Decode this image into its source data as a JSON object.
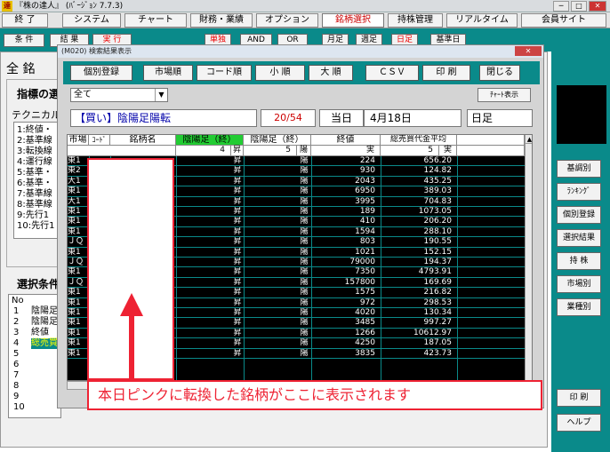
{
  "window": {
    "title": "『株の達人』 (ﾊﾞｰｼﾞｮﾝ 7.7.3)",
    "icon_text": "達",
    "btn_min": "─",
    "btn_max": "□",
    "btn_close": "✕"
  },
  "menu": [
    "終 了",
    "システム",
    "チャート",
    "財務・業績",
    "オプション",
    "銘柄選択",
    "持株管理",
    "リアルタイム",
    "会員サイト"
  ],
  "toolbar": {
    "left": [
      "条 件",
      "結 果",
      "実 行"
    ],
    "right": [
      "単独",
      "AND",
      "OR",
      "月足",
      "週足",
      "日足",
      "基準日"
    ]
  },
  "background": {
    "label1": "全 銘",
    "label2": "指標の選",
    "label3": "テクニカル",
    "list": [
      "1:終値・",
      "2:基準線",
      "3:転換線",
      "4:運行線",
      "5:基準・",
      "6:基準・",
      "7:基準線",
      "8:基準線",
      "9:先行1",
      "10:先行1"
    ],
    "sel_label": "選択条件",
    "sel_head": "No",
    "sel_rows": [
      {
        "no": "1",
        "val": "陰陽足"
      },
      {
        "no": "2",
        "val": "陰陽足"
      },
      {
        "no": "3",
        "val": "終値"
      },
      {
        "no": "4",
        "val": "総売買"
      },
      {
        "no": "5",
        "val": ""
      },
      {
        "no": "6",
        "val": ""
      },
      {
        "no": "7",
        "val": ""
      },
      {
        "no": "8",
        "val": ""
      },
      {
        "no": "9",
        "val": ""
      },
      {
        "no": "10",
        "val": ""
      }
    ]
  },
  "side": [
    "基調別",
    "ﾗﾝｷﾝｸﾞ",
    "個別登録",
    "選択結果",
    "持 株",
    "市場別",
    "業種別",
    "印 刷",
    "ヘルプ"
  ],
  "dialog": {
    "title": "(M020) 検索結果表示",
    "buttons": [
      "個別登録",
      "市場順",
      "コード順",
      "小 順",
      "大 順",
      "ＣＳＶ",
      "印 刷",
      "閉じる"
    ],
    "filter": "全て",
    "chart_btn": "ﾁｬｰﾄ表示",
    "info": {
      "label": "【買い】陰陽足陽転",
      "count": "20/54",
      "date_label": "当日",
      "date": "4月18日",
      "period": "日足"
    },
    "columns": [
      "市場",
      "ｺｰﾄﾞ",
      "銘柄名",
      "陰陽足（終）",
      "陰陽足（終）",
      "終値",
      "総売買代金平均"
    ],
    "subrow": {
      "c1": "4",
      "c1s": "昇",
      "c2": "5",
      "c2s": "陽",
      "c3": "実",
      "c4": "5",
      "c4s": "実"
    },
    "rows": [
      [
        "東1",
        "昇",
        "陽",
        "224",
        "656.20"
      ],
      [
        "東2",
        "昇",
        "陽",
        "930",
        "124.82"
      ],
      [
        "大1",
        "昇",
        "陽",
        "2043",
        "435.25"
      ],
      [
        "東1",
        "昇",
        "陽",
        "6950",
        "389.03"
      ],
      [
        "大1",
        "昇",
        "陽",
        "3995",
        "704.83"
      ],
      [
        "東1",
        "昇",
        "陽",
        "189",
        "1073.05"
      ],
      [
        "東1",
        "昇",
        "陽",
        "410",
        "206.20"
      ],
      [
        "東1",
        "昇",
        "陽",
        "1594",
        "288.10"
      ],
      [
        "ＪＱ",
        "昇",
        "陽",
        "803",
        "190.55"
      ],
      [
        "東1",
        "昇",
        "陽",
        "1021",
        "152.15"
      ],
      [
        "ＪＱ",
        "昇",
        "陽",
        "79000",
        "194.37"
      ],
      [
        "東1",
        "昇",
        "陽",
        "7350",
        "4793.91"
      ],
      [
        "ＪＱ",
        "昇",
        "陽",
        "157800",
        "169.69"
      ],
      [
        "東1",
        "昇",
        "陽",
        "1575",
        "216.82"
      ],
      [
        "東1",
        "昇",
        "陽",
        "972",
        "298.53"
      ],
      [
        "東1",
        "昇",
        "陽",
        "4020",
        "130.34"
      ],
      [
        "東1",
        "昇",
        "陽",
        "3485",
        "997.27"
      ],
      [
        "東1",
        "昇",
        "陽",
        "1266",
        "10612.97"
      ],
      [
        "東1",
        "昇",
        "陽",
        "4250",
        "187.05"
      ],
      [
        "東1",
        "昇",
        "陽",
        "3835",
        "423.73"
      ]
    ]
  },
  "annotation": {
    "text": "本日ピンクに転換した銘柄がここに表示されます",
    "color": "#e02030"
  }
}
